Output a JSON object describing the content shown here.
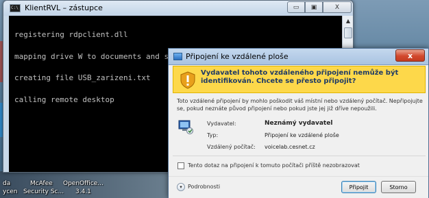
{
  "console": {
    "title": "KlientRVL – zástupce",
    "icon_label": "C:\\",
    "lines": [
      "registering rdpclient.dll",
      "mapping drive W to documents and settings folder",
      "creating file USB_zarizeni.txt",
      "calling remote desktop"
    ],
    "buttons": [
      "minimize-icon",
      "maximize-icon",
      "close-icon"
    ],
    "minimize_glyph": "▭",
    "maximize_glyph": "▣",
    "close_glyph": "X",
    "scroll_up": "▲",
    "scroll_down": "▼"
  },
  "dialog": {
    "title": "Připojení ke vzdálené ploše",
    "close_glyph": "x",
    "warning": "Vydavatel tohoto vzdáleného připojení nemůže být identifikován. Chcete se přesto připojit?",
    "description": "Toto vzdálené připojení by mohlo poškodit váš místní nebo vzdálený počítač. Nepřipojujte se, pokud neznáte původ připojení nebo pokud jste jej již dříve nepoužili.",
    "info": [
      {
        "label": "Vydavatel:",
        "value": "Neznámý vydavatel"
      },
      {
        "label": "Typ:",
        "value": "Připojení ke vzdálené ploše"
      },
      {
        "label": "Vzdálený počítač:",
        "value": "voicelab.cesnet.cz"
      }
    ],
    "checkbox_label": "Tento dotaz na připojení k tomuto počítači příště nezobrazovat",
    "details_label": "Podrobnosti",
    "details_glyph": "▾",
    "connect_label": "Připojit",
    "cancel_label": "Storno"
  },
  "desktop": {
    "icons": [
      {
        "label_line1": "da",
        "label_line2": "ycen"
      },
      {
        "label_line1": "McAfee",
        "label_line2": "Security Sc..."
      },
      {
        "label_line1": "OpenOffice...",
        "label_line2": "3.4.1"
      }
    ]
  },
  "colors": {
    "warning_band": "#fdd84a",
    "warning_text": "#1e3a66",
    "console_bg": "#000000",
    "console_text": "#c0c0c0",
    "close_button": "#d2482d"
  }
}
